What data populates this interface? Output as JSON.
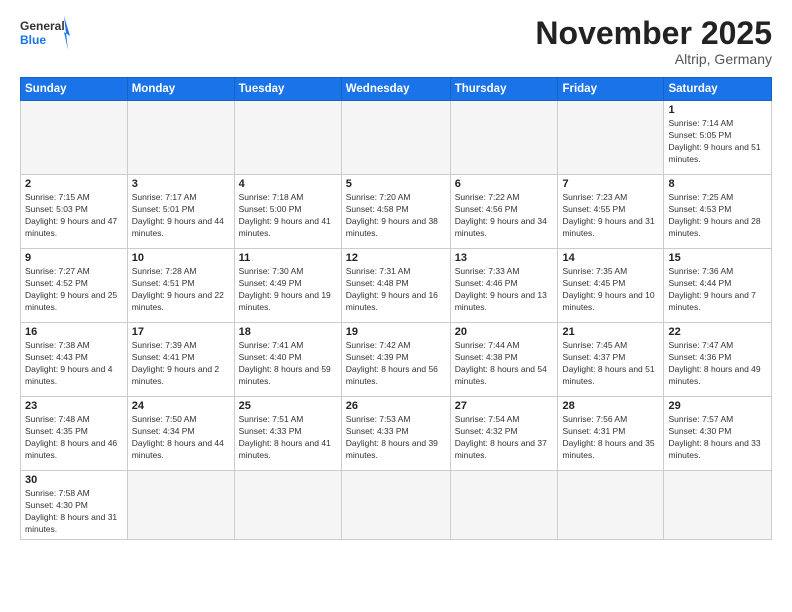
{
  "header": {
    "logo_general": "General",
    "logo_blue": "Blue",
    "month_title": "November 2025",
    "location": "Altrip, Germany"
  },
  "days_of_week": [
    "Sunday",
    "Monday",
    "Tuesday",
    "Wednesday",
    "Thursday",
    "Friday",
    "Saturday"
  ],
  "weeks": [
    [
      {
        "day": "",
        "info": ""
      },
      {
        "day": "",
        "info": ""
      },
      {
        "day": "",
        "info": ""
      },
      {
        "day": "",
        "info": ""
      },
      {
        "day": "",
        "info": ""
      },
      {
        "day": "",
        "info": ""
      },
      {
        "day": "1",
        "info": "Sunrise: 7:14 AM\nSunset: 5:05 PM\nDaylight: 9 hours and 51 minutes."
      }
    ],
    [
      {
        "day": "2",
        "info": "Sunrise: 7:15 AM\nSunset: 5:03 PM\nDaylight: 9 hours and 47 minutes."
      },
      {
        "day": "3",
        "info": "Sunrise: 7:17 AM\nSunset: 5:01 PM\nDaylight: 9 hours and 44 minutes."
      },
      {
        "day": "4",
        "info": "Sunrise: 7:18 AM\nSunset: 5:00 PM\nDaylight: 9 hours and 41 minutes."
      },
      {
        "day": "5",
        "info": "Sunrise: 7:20 AM\nSunset: 4:58 PM\nDaylight: 9 hours and 38 minutes."
      },
      {
        "day": "6",
        "info": "Sunrise: 7:22 AM\nSunset: 4:56 PM\nDaylight: 9 hours and 34 minutes."
      },
      {
        "day": "7",
        "info": "Sunrise: 7:23 AM\nSunset: 4:55 PM\nDaylight: 9 hours and 31 minutes."
      },
      {
        "day": "8",
        "info": "Sunrise: 7:25 AM\nSunset: 4:53 PM\nDaylight: 9 hours and 28 minutes."
      }
    ],
    [
      {
        "day": "9",
        "info": "Sunrise: 7:27 AM\nSunset: 4:52 PM\nDaylight: 9 hours and 25 minutes."
      },
      {
        "day": "10",
        "info": "Sunrise: 7:28 AM\nSunset: 4:51 PM\nDaylight: 9 hours and 22 minutes."
      },
      {
        "day": "11",
        "info": "Sunrise: 7:30 AM\nSunset: 4:49 PM\nDaylight: 9 hours and 19 minutes."
      },
      {
        "day": "12",
        "info": "Sunrise: 7:31 AM\nSunset: 4:48 PM\nDaylight: 9 hours and 16 minutes."
      },
      {
        "day": "13",
        "info": "Sunrise: 7:33 AM\nSunset: 4:46 PM\nDaylight: 9 hours and 13 minutes."
      },
      {
        "day": "14",
        "info": "Sunrise: 7:35 AM\nSunset: 4:45 PM\nDaylight: 9 hours and 10 minutes."
      },
      {
        "day": "15",
        "info": "Sunrise: 7:36 AM\nSunset: 4:44 PM\nDaylight: 9 hours and 7 minutes."
      }
    ],
    [
      {
        "day": "16",
        "info": "Sunrise: 7:38 AM\nSunset: 4:43 PM\nDaylight: 9 hours and 4 minutes."
      },
      {
        "day": "17",
        "info": "Sunrise: 7:39 AM\nSunset: 4:41 PM\nDaylight: 9 hours and 2 minutes."
      },
      {
        "day": "18",
        "info": "Sunrise: 7:41 AM\nSunset: 4:40 PM\nDaylight: 8 hours and 59 minutes."
      },
      {
        "day": "19",
        "info": "Sunrise: 7:42 AM\nSunset: 4:39 PM\nDaylight: 8 hours and 56 minutes."
      },
      {
        "day": "20",
        "info": "Sunrise: 7:44 AM\nSunset: 4:38 PM\nDaylight: 8 hours and 54 minutes."
      },
      {
        "day": "21",
        "info": "Sunrise: 7:45 AM\nSunset: 4:37 PM\nDaylight: 8 hours and 51 minutes."
      },
      {
        "day": "22",
        "info": "Sunrise: 7:47 AM\nSunset: 4:36 PM\nDaylight: 8 hours and 49 minutes."
      }
    ],
    [
      {
        "day": "23",
        "info": "Sunrise: 7:48 AM\nSunset: 4:35 PM\nDaylight: 8 hours and 46 minutes."
      },
      {
        "day": "24",
        "info": "Sunrise: 7:50 AM\nSunset: 4:34 PM\nDaylight: 8 hours and 44 minutes."
      },
      {
        "day": "25",
        "info": "Sunrise: 7:51 AM\nSunset: 4:33 PM\nDaylight: 8 hours and 41 minutes."
      },
      {
        "day": "26",
        "info": "Sunrise: 7:53 AM\nSunset: 4:33 PM\nDaylight: 8 hours and 39 minutes."
      },
      {
        "day": "27",
        "info": "Sunrise: 7:54 AM\nSunset: 4:32 PM\nDaylight: 8 hours and 37 minutes."
      },
      {
        "day": "28",
        "info": "Sunrise: 7:56 AM\nSunset: 4:31 PM\nDaylight: 8 hours and 35 minutes."
      },
      {
        "day": "29",
        "info": "Sunrise: 7:57 AM\nSunset: 4:30 PM\nDaylight: 8 hours and 33 minutes."
      }
    ],
    [
      {
        "day": "30",
        "info": "Sunrise: 7:58 AM\nSunset: 4:30 PM\nDaylight: 8 hours and 31 minutes."
      },
      {
        "day": "",
        "info": ""
      },
      {
        "day": "",
        "info": ""
      },
      {
        "day": "",
        "info": ""
      },
      {
        "day": "",
        "info": ""
      },
      {
        "day": "",
        "info": ""
      },
      {
        "day": "",
        "info": ""
      }
    ]
  ]
}
